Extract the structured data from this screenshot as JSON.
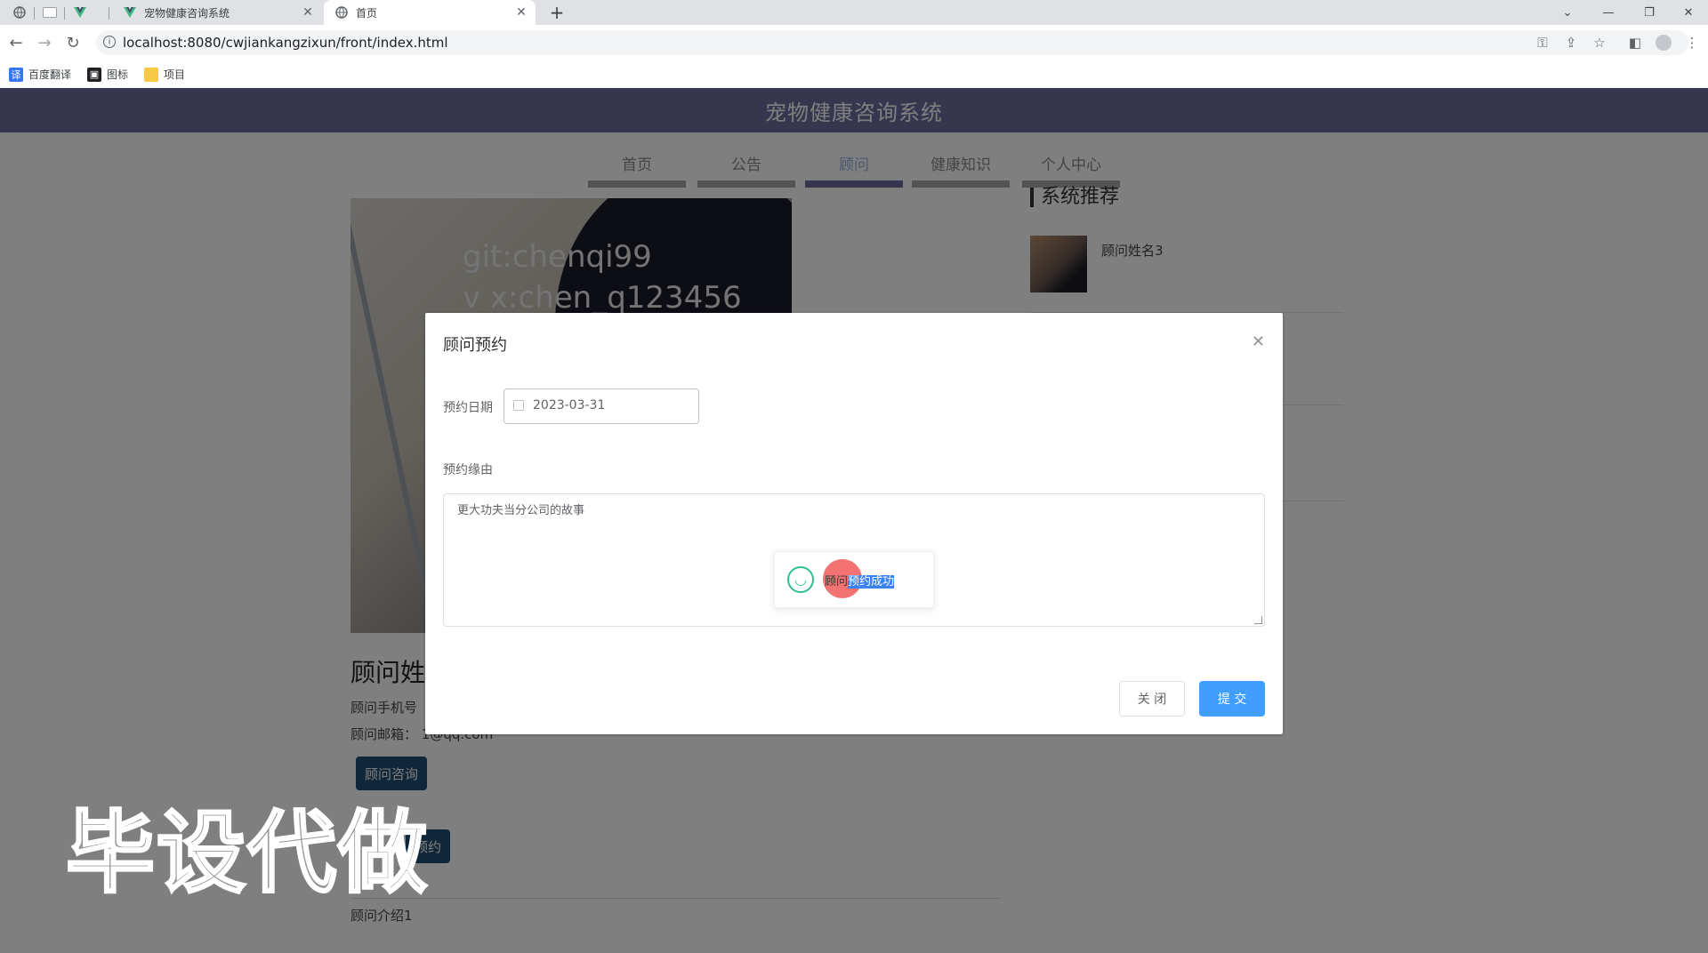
{
  "browser": {
    "tabs": [
      {
        "label": "宠物健康咨询系统",
        "active": false
      },
      {
        "label": "首页",
        "active": true
      }
    ],
    "url": "localhost:8080/cwjiankangzixun/front/index.html",
    "bookmarks": [
      {
        "label": "百度翻译",
        "icon": "translate-icon"
      },
      {
        "label": "图标",
        "icon": "image-icon"
      },
      {
        "label": "项目",
        "icon": "folder-icon"
      }
    ]
  },
  "site": {
    "title": "宠物健康咨询系统",
    "nav": [
      {
        "label": "首页",
        "active": false
      },
      {
        "label": "公告",
        "active": false
      },
      {
        "label": "顾问",
        "active": true
      },
      {
        "label": "健康知识",
        "active": false
      },
      {
        "label": "个人中心",
        "active": false
      }
    ]
  },
  "detail": {
    "watermark_line1": "git:chenqi99",
    "watermark_line2": "v x:chen_q123456",
    "name": "顾问姓",
    "phone_label": "顾问手机号",
    "email_label": "顾问邮箱：",
    "email_value": "1@qq.com",
    "consult_button": "顾问咨询",
    "reserve_button": "预约",
    "intro": "顾问介绍1"
  },
  "sidebar": {
    "title": "系统推荐",
    "items": [
      {
        "name": "顾问姓名3"
      }
    ]
  },
  "dialog": {
    "title": "顾问预约",
    "date_label": "预约日期",
    "date_value": "2023-03-31",
    "reason_label": "预约缘由",
    "reason_value": "更大功夫当分公司的故事",
    "toast_prefix": "顾问",
    "toast_selected": "预约成功",
    "close_button": "关 闭",
    "submit_button": "提 交"
  },
  "overlay_stamp": "毕设代做",
  "colors": {
    "header": "#6c6d9d",
    "nav_active": "#9ab1dd",
    "primary": "#409eff",
    "dark_button": "#1f4e72"
  }
}
